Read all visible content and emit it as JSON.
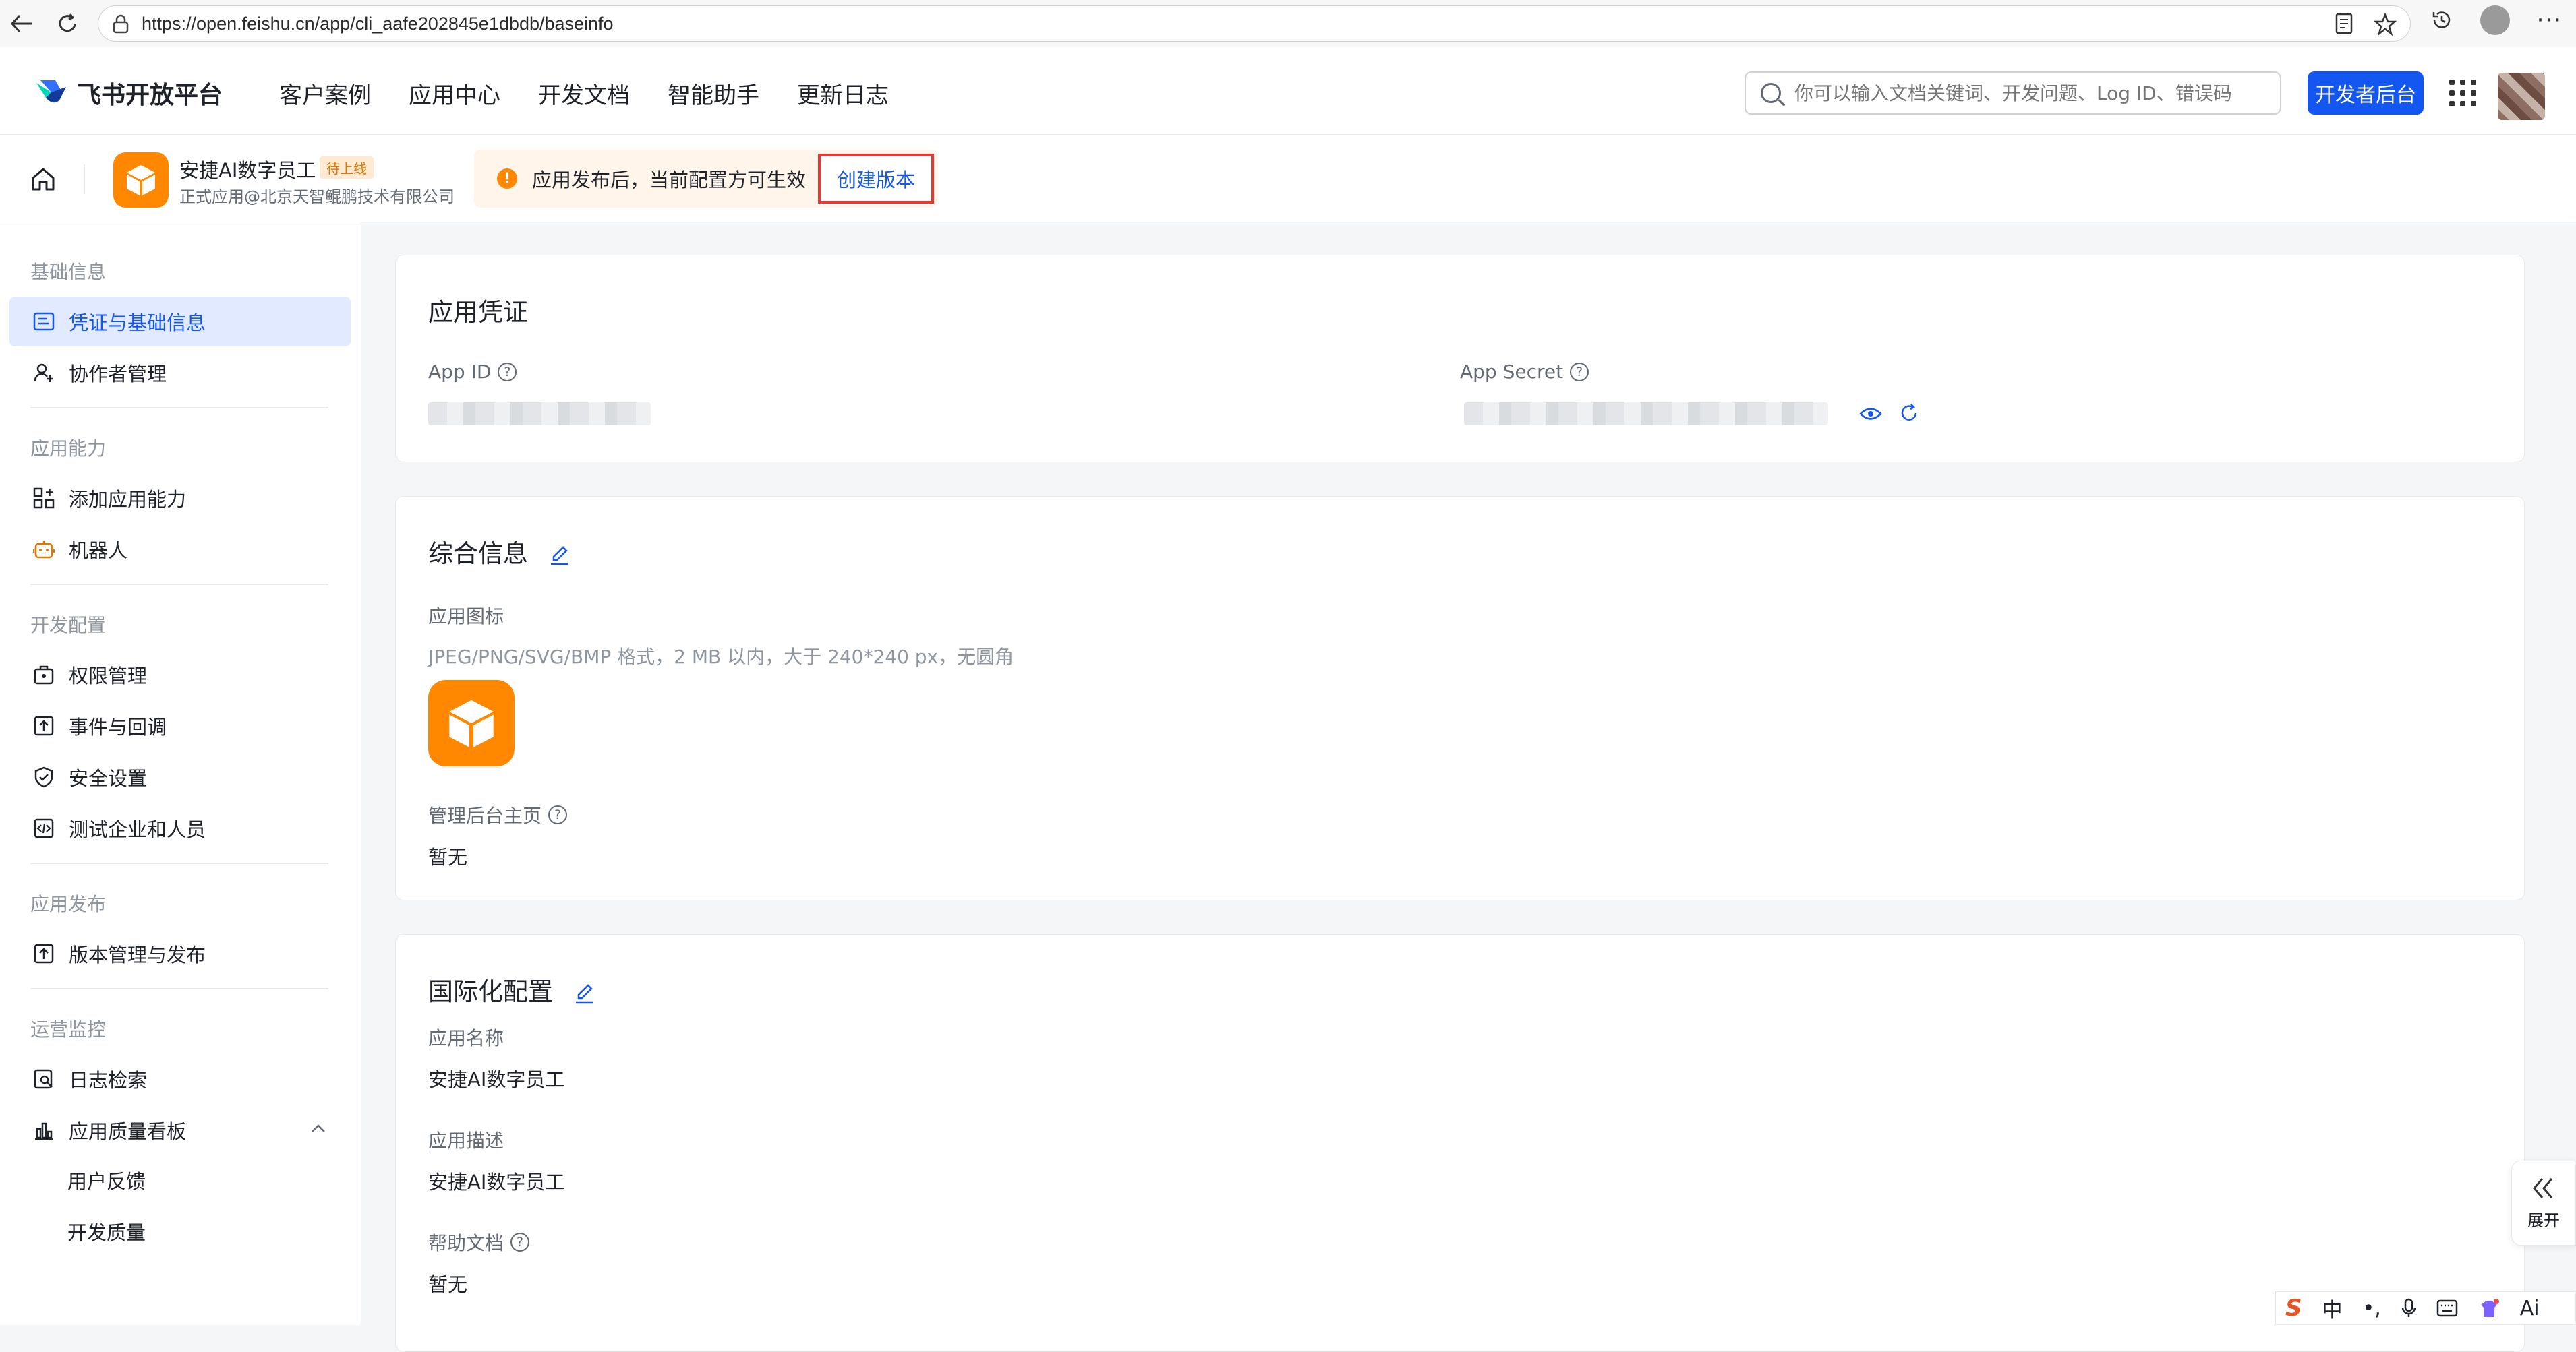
{
  "browser": {
    "url": "https://open.feishu.cn/app/cli_aafe202845e1dbdb/baseinfo"
  },
  "topnav": {
    "brand": "飞书开放平台",
    "items": [
      "客户案例",
      "应用中心",
      "开发文档",
      "智能助手",
      "更新日志"
    ],
    "search_placeholder": "你可以输入文档关键词、开发问题、Log ID、错误码",
    "dev_button": "开发者后台"
  },
  "app": {
    "name": "安捷AI数字员工",
    "badge": "待上线",
    "org": "正式应用@北京天智鲲鹏技术有限公司",
    "notice": "应用发布后，当前配置方可生效",
    "create_version": "创建版本"
  },
  "sidebar": {
    "groups": {
      "basic": "基础信息",
      "capability": "应用能力",
      "dev": "开发配置",
      "publish": "应用发布",
      "monitor": "运营监控"
    },
    "items": {
      "credentials": "凭证与基础信息",
      "collaborators": "协作者管理",
      "add_capability": "添加应用能力",
      "bot": "机器人",
      "permissions": "权限管理",
      "events": "事件与回调",
      "security": "安全设置",
      "test": "测试企业和人员",
      "versions": "版本管理与发布",
      "logs": "日志检索",
      "quality": "应用质量看板",
      "feedback": "用户反馈",
      "dev_quality": "开发质量"
    }
  },
  "credentials_card": {
    "title": "应用凭证",
    "app_id_label": "App ID",
    "app_secret_label": "App Secret"
  },
  "general_card": {
    "title": "综合信息",
    "icon_label": "应用图标",
    "icon_hint": "JPEG/PNG/SVG/BMP 格式，2 MB 以内，大于 240*240 px，无圆角",
    "admin_home_label": "管理后台主页",
    "admin_home_value": "暂无"
  },
  "i18n_card": {
    "title": "国际化配置",
    "name_label": "应用名称",
    "name_value": "安捷AI数字员工",
    "desc_label": "应用描述",
    "desc_value": "安捷AI数字员工",
    "help_label": "帮助文档",
    "help_value": "暂无"
  },
  "expand_label": "展开",
  "ime": {
    "lang": "中",
    "punct": "•,",
    "ai": "Aі"
  },
  "colors": {
    "primary": "#1456f0",
    "app_orange": "#ff8800",
    "highlight_red": "#e53935"
  }
}
